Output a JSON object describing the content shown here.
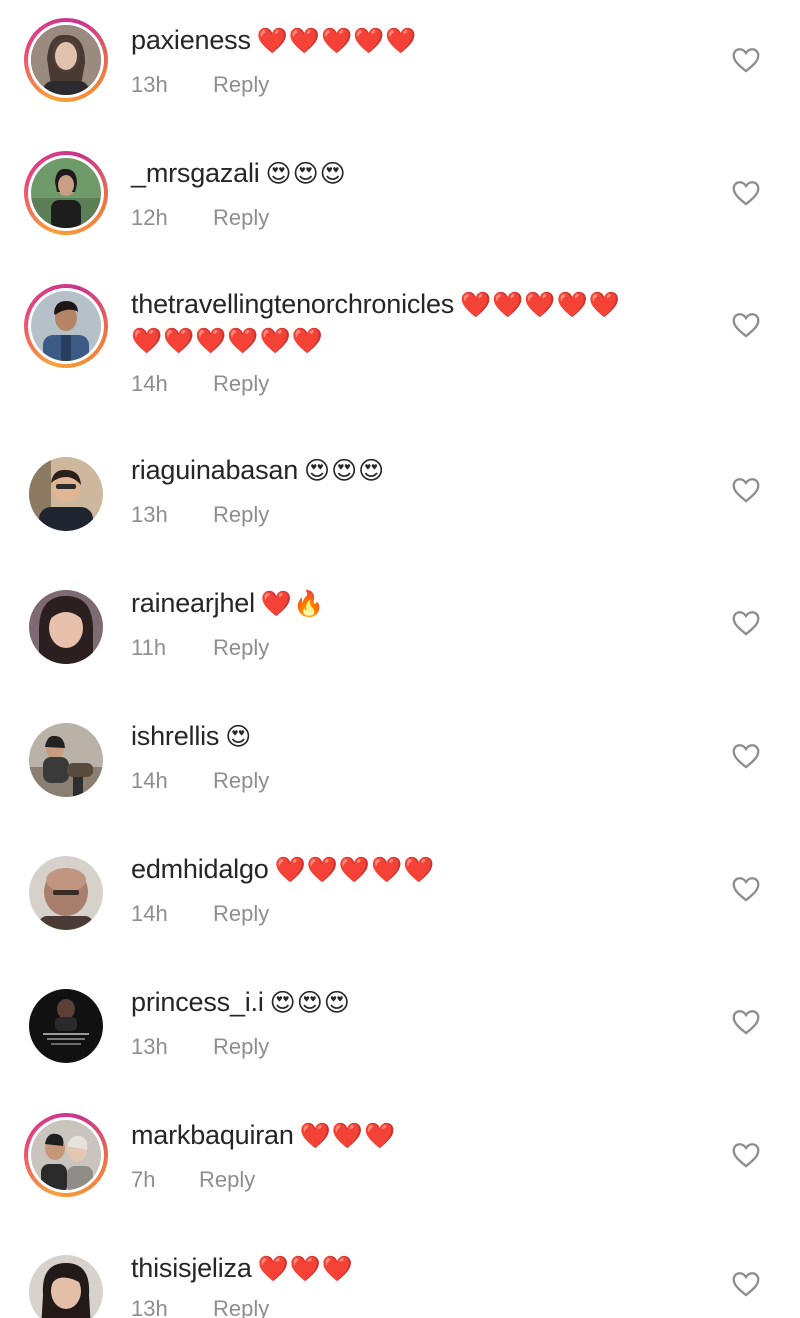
{
  "comments": [
    {
      "username": "paxieness",
      "text": "❤️❤️❤️❤️❤️",
      "time": "13h",
      "reply": "Reply",
      "story": true,
      "avatar": "portrait-icon"
    },
    {
      "username": "_mrsgazali",
      "text": "😍😍😍",
      "time": "12h",
      "reply": "Reply",
      "story": true,
      "avatar": "portrait-icon"
    },
    {
      "username": "thetravellingtenorchronicles",
      "text": "❤️❤️❤️❤️❤️",
      "text2": "❤️❤️❤️❤️❤️❤️",
      "time": "14h",
      "reply": "Reply",
      "story": true,
      "avatar": "portrait-icon"
    },
    {
      "username": "riaguinabasan",
      "text": "😍😍😍",
      "time": "13h",
      "reply": "Reply",
      "story": false,
      "avatar": "portrait-icon"
    },
    {
      "username": "rainearjhel",
      "text": "❤️🔥",
      "time": "11h",
      "reply": "Reply",
      "story": false,
      "avatar": "portrait-icon"
    },
    {
      "username": "ishrellis",
      "text": "😍",
      "time": "14h",
      "reply": "Reply",
      "story": false,
      "avatar": "portrait-icon"
    },
    {
      "username": "edmhidalgo",
      "text": "❤️❤️❤️❤️❤️",
      "time": "14h",
      "reply": "Reply",
      "story": false,
      "avatar": "portrait-icon"
    },
    {
      "username": "princess_i.i",
      "text": "😍😍😍",
      "time": "13h",
      "reply": "Reply",
      "story": false,
      "avatar": "portrait-icon"
    },
    {
      "username": "markbaquiran",
      "text": "❤️❤️❤️",
      "time": "7h",
      "reply": "Reply",
      "story": true,
      "avatar": "portrait-icon"
    },
    {
      "username": "thisisjeliza",
      "text": "❤️❤️❤️",
      "time": "13h",
      "reply": "Reply",
      "story": false,
      "avatar": "portrait-icon"
    }
  ],
  "colors": {
    "username": "#262626",
    "meta": "#8e8e8e",
    "heart": "#ed2939",
    "like_outline": "#8e8e8e"
  },
  "icons": {
    "like": "heart-outline-icon"
  }
}
